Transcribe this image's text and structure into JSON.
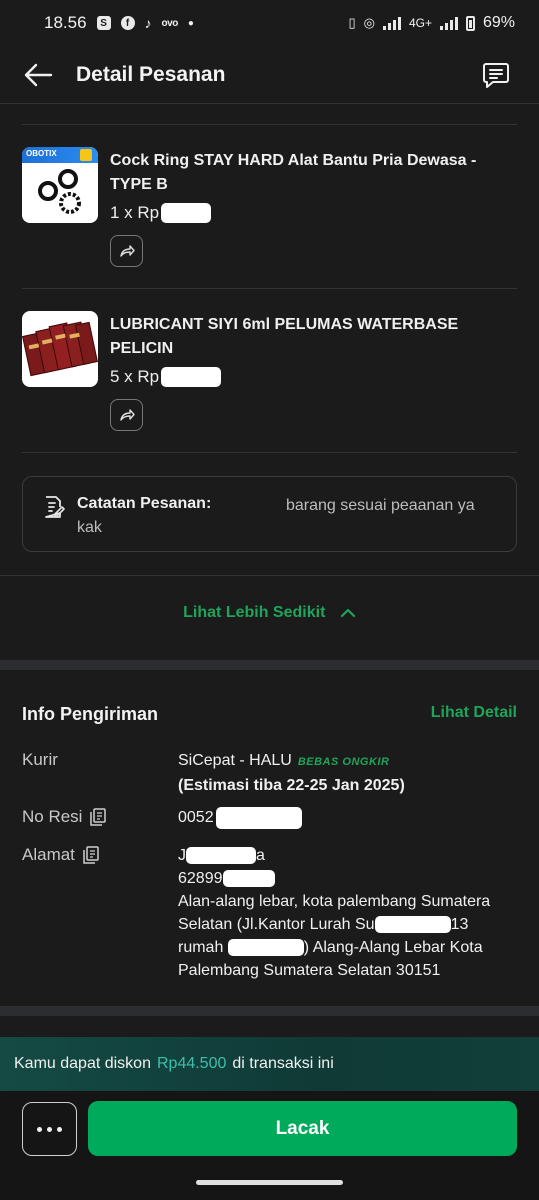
{
  "status_bar": {
    "time": "18.56",
    "network": "4G+",
    "battery": "69%"
  },
  "header": {
    "title": "Detail Pesanan",
    "icons": [
      "arrow-left-icon",
      "chat-icon"
    ]
  },
  "products": [
    {
      "name": "Cock Ring STAY HARD Alat Bantu Pria Dewasa - TYPE B",
      "qty_prefix": "1 x Rp",
      "thumb_brand": "OBOTIX"
    },
    {
      "name": "LUBRICANT SIYI 6ml PELUMAS WATERBASE PELICIN",
      "qty_prefix": "5 x Rp"
    }
  ],
  "note": {
    "label": "Catatan Pesanan:",
    "text": "barang sesuai peaanan ya kak"
  },
  "see_less": "Lihat Lebih Sedikit",
  "shipping": {
    "title": "Info Pengiriman",
    "detail_link": "Lihat Detail",
    "courier_label": "Kurir",
    "courier_value": "SiCepat - HALU",
    "free_shipping_badge": "BEBAS ONGKIR",
    "estimate": "(Estimasi tiba 22-25 Jan 2025)",
    "resi_label": "No Resi",
    "resi_value": "0052",
    "address_label": "Alamat",
    "addr_name_start": "J",
    "addr_name_end": "a",
    "addr_phone": "62899",
    "addr_line3": "Alan-alang lebar, kota palembang Sumatera",
    "addr_line4_a": "Selatan (Jl.Kantor Lurah Su",
    "addr_line4_b": "13",
    "addr_line5_a": "rumah ",
    "addr_line5_b": ") Alang-Alang Lebar Kota",
    "addr_line6": "Palembang Sumatera Selatan 30151"
  },
  "discount": {
    "prefix": "Kamu dapat diskon",
    "amount": "Rp44.500",
    "suffix": "di transaksi ini"
  },
  "actions": {
    "track": "Lacak"
  },
  "colors": {
    "accent_green": "#00aa5b",
    "link_green": "#1fa45a",
    "background": "#1b1b1b"
  }
}
